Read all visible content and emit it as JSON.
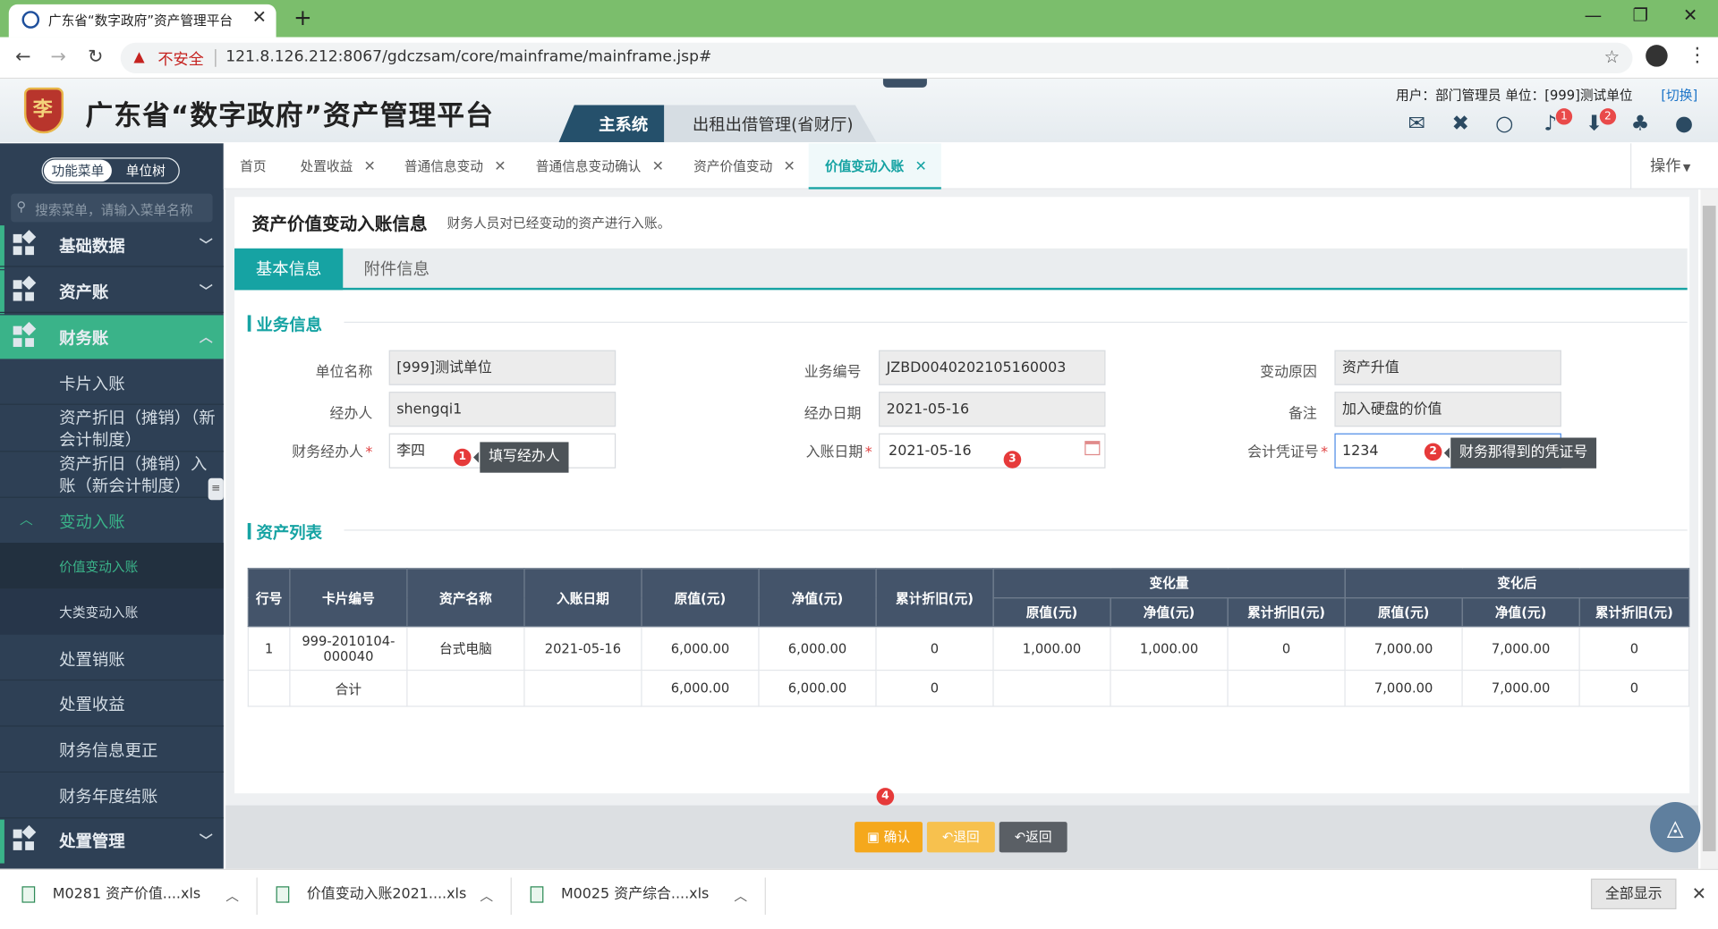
{
  "browser": {
    "tab_title": "广东省“数字政府”资产管理平台",
    "insecure_label": "不安全",
    "url": "121.8.126.212:8067/gdczsam/core/mainframe/mainframe.jsp#"
  },
  "header": {
    "app_title": "广东省“数字政府”资产管理平台",
    "logo_char": "李",
    "system_tabs": [
      "主系统",
      "出租出借管理(省财厅)"
    ],
    "user_info": "用户：部门管理员    单位：[999]测试单位",
    "switch_link": "[切换]",
    "badges": [
      "1",
      "2"
    ]
  },
  "sidebar": {
    "toggle": [
      "功能菜单",
      "单位树"
    ],
    "search_placeholder": "搜索菜单，请输入菜单名称",
    "groups": [
      "基础数据",
      "资产账",
      "财务账",
      "处置管理"
    ],
    "items": {
      "card_entry": "卡片入账",
      "depreciation_new": "资产折旧（摊销）（新会计制度）",
      "depreciation_entry": "资产折旧（摊销）入账（新会计制度）",
      "change_entry": "变动入账",
      "value_change_entry": "价值变动入账",
      "class_change_entry": "大类变动入账",
      "disposal_writeoff": "处置销账",
      "disposal_income": "处置收益",
      "finance_correct": "财务信息更正",
      "finance_year_end": "财务年度结账"
    }
  },
  "content_tabs": [
    "首页",
    "处置收益",
    "普通信息变动",
    "普通信息变动确认",
    "资产价值变动",
    "价值变动入账"
  ],
  "operations_label": "操作",
  "page": {
    "title": "资产价值变动入账信息",
    "description": "财务人员对已经变动的资产进行入账。",
    "subtabs": [
      "基本信息",
      "附件信息"
    ],
    "section_business": "业务信息",
    "section_assets": "资产列表"
  },
  "form": {
    "unit_name": {
      "label": "单位名称",
      "value": "[999]测试单位"
    },
    "business_no": {
      "label": "业务编号",
      "value": "JZBD0040202105160003"
    },
    "change_reason": {
      "label": "变动原因",
      "value": "资产升值"
    },
    "handler": {
      "label": "经办人",
      "value": "shengqi1"
    },
    "handle_date": {
      "label": "经办日期",
      "value": "2021-05-16"
    },
    "remark": {
      "label": "备注",
      "value": "加入硬盘的价值"
    },
    "finance_handler": {
      "label": "财务经办人",
      "value": "李四"
    },
    "entry_date": {
      "label": "入账日期",
      "value": "2021-05-16"
    },
    "voucher_no": {
      "label": "会计凭证号",
      "value": "1234"
    },
    "required_mark": "*"
  },
  "annotations": {
    "markers": [
      "1",
      "2",
      "3",
      "4"
    ],
    "tip_handler": "填写经办人",
    "tip_voucher": "财务那得到的凭证号"
  },
  "table": {
    "header_row1": [
      "行号",
      "卡片编号",
      "资产名称",
      "入账日期",
      "原值(元)",
      "净值(元)",
      "累计折旧(元)",
      "变化量",
      "变化后"
    ],
    "header_row2": [
      "原值(元)",
      "净值(元)",
      "累计折旧(元)",
      "原值(元)",
      "净值(元)",
      "累计折旧(元)"
    ],
    "rows": [
      [
        "1",
        "999-2010104-000040",
        "台式电脑",
        "2021-05-16",
        "6,000.00",
        "6,000.00",
        "0",
        "1,000.00",
        "1,000.00",
        "0",
        "7,000.00",
        "7,000.00",
        "0"
      ],
      [
        "",
        "合计",
        "",
        "",
        "6,000.00",
        "6,000.00",
        "0",
        "",
        "",
        "",
        "7,000.00",
        "7,000.00",
        "0"
      ]
    ]
  },
  "buttons": {
    "confirm": "确认",
    "back": "退回",
    "return": "返回"
  },
  "downloads": {
    "files": [
      "M0281 资产价值....xls",
      "价值变动入账2021....xls",
      "M0025 资产综合....xls"
    ],
    "show_all": "全部显示"
  }
}
